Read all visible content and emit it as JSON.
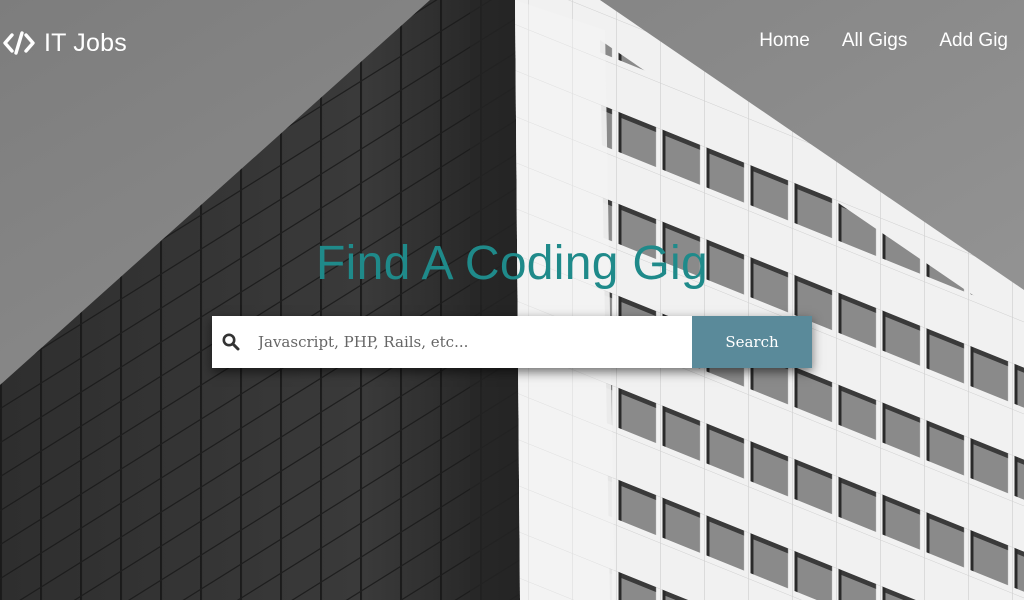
{
  "header": {
    "brand": "IT Jobs",
    "brand_icon": "code-icon",
    "nav": [
      {
        "label": "Home"
      },
      {
        "label": "All Gigs"
      },
      {
        "label": "Add Gig"
      }
    ]
  },
  "hero": {
    "title": "Find A Coding Gig",
    "title_color": "#1f8a8a"
  },
  "search": {
    "icon": "search-icon",
    "placeholder": "Javascript, PHP, Rails, etc...",
    "value": "",
    "button_label": "Search",
    "button_color": "#5a8a9a"
  }
}
